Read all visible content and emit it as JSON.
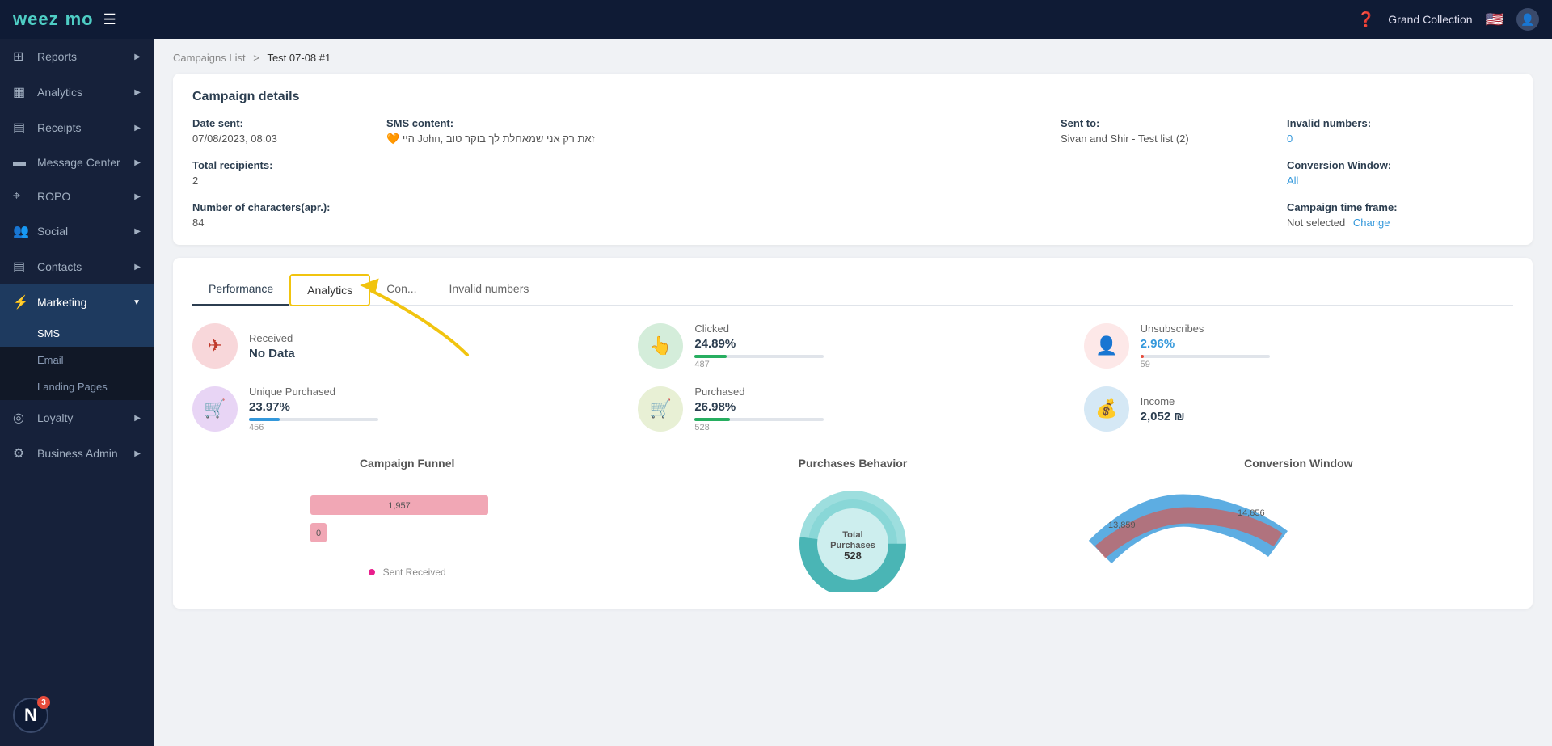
{
  "app": {
    "name_part1": "weez",
    "name_part2": "mo",
    "store": "Grand Collection"
  },
  "topnav": {
    "help_label": "?",
    "flag": "🇺🇸"
  },
  "sidebar": {
    "items": [
      {
        "id": "reports",
        "label": "Reports",
        "icon": "⊞",
        "expandable": true
      },
      {
        "id": "analytics",
        "label": "Analytics",
        "icon": "▦",
        "expandable": true
      },
      {
        "id": "receipts",
        "label": "Receipts",
        "icon": "▤",
        "expandable": true
      },
      {
        "id": "message-center",
        "label": "Message Center",
        "icon": "▬",
        "expandable": true
      },
      {
        "id": "ropo",
        "label": "ROPO",
        "icon": "⌖",
        "expandable": true
      },
      {
        "id": "social",
        "label": "Social",
        "icon": "👥",
        "expandable": true
      },
      {
        "id": "contacts",
        "label": "Contacts",
        "icon": "▤",
        "expandable": true
      },
      {
        "id": "marketing",
        "label": "Marketing",
        "icon": "⚡",
        "expandable": true,
        "active": true
      },
      {
        "id": "loyalty",
        "label": "Loyalty",
        "icon": "◎",
        "expandable": true
      },
      {
        "id": "business-admin",
        "label": "Business Admin",
        "icon": "⚙",
        "expandable": true
      }
    ],
    "sub_items": [
      {
        "id": "sms",
        "label": "SMS",
        "active": true
      },
      {
        "id": "email",
        "label": "Email",
        "active": false
      },
      {
        "id": "landing-pages",
        "label": "Landing Pages",
        "active": false
      }
    ],
    "notification": {
      "count": "3"
    }
  },
  "breadcrumb": {
    "parent": "Campaigns List",
    "separator": ">",
    "current": "Test 07-08 #1"
  },
  "campaign_details": {
    "title": "Campaign details",
    "date_sent_label": "Date sent:",
    "date_sent_value": "07/08/2023, 08:03",
    "total_recipients_label": "Total recipients:",
    "total_recipients_value": "2",
    "num_characters_label": "Number of characters(apr.):",
    "num_characters_value": "84",
    "sms_content_label": "SMS content:",
    "sms_content_emoji": "🧡",
    "sms_content_text": "היי John, זאת רק אני שמאחלת לך בוקר טוב",
    "sent_to_label": "Sent to:",
    "sent_to_value": "Sivan and Shir - Test list (2)",
    "invalid_numbers_label": "Invalid numbers:",
    "invalid_numbers_value": "0",
    "conversion_window_label": "Conversion Window:",
    "conversion_window_value": "All",
    "campaign_timeframe_label": "Campaign time frame:",
    "campaign_timeframe_not_selected": "Not selected",
    "campaign_timeframe_change": "Change"
  },
  "tabs": [
    {
      "id": "performance",
      "label": "Performance",
      "active": true
    },
    {
      "id": "analytics",
      "label": "Analytics",
      "active": false,
      "highlighted": true
    },
    {
      "id": "conversion",
      "label": "Con...",
      "active": false
    },
    {
      "id": "invalid",
      "label": "Invalid numbers",
      "active": false
    }
  ],
  "annotation": {
    "tab_pointing_to": "Analytics"
  },
  "stats": [
    {
      "id": "received",
      "title": "Received",
      "value": "No Data",
      "icon_type": "pink",
      "icon": "✈",
      "show_bar": false,
      "colored": false
    },
    {
      "id": "clicked",
      "title": "Clicked",
      "value": "24.89%",
      "count": "487",
      "icon_type": "green",
      "icon": "👆",
      "bar_width": "25",
      "bar_color": "green-bar",
      "show_bar": true,
      "colored": false
    },
    {
      "id": "unsubscribes",
      "title": "Unsubscribes",
      "value": "2.96%",
      "count": "59",
      "icon_type": "red-outline",
      "icon": "👤",
      "bar_width": "3",
      "bar_color": "red-bar",
      "show_bar": true,
      "colored": true
    },
    {
      "id": "unique-purchased",
      "title": "Unique Purchased",
      "value": "23.97%",
      "count": "456",
      "icon_type": "purple",
      "icon": "🛒",
      "bar_width": "24",
      "bar_color": "blue-bar",
      "show_bar": true,
      "colored": false
    },
    {
      "id": "purchased",
      "title": "Purchased",
      "value": "26.98%",
      "count": "528",
      "icon_type": "olive",
      "icon": "🛒",
      "bar_width": "27",
      "bar_color": "green-bar",
      "show_bar": true,
      "colored": false
    },
    {
      "id": "income",
      "title": "Income",
      "value": "2,052 ₪",
      "icon_type": "blue",
      "icon": "💰",
      "show_bar": false,
      "colored": false
    }
  ],
  "bottom_sections": {
    "funnel": {
      "title": "Campaign Funnel",
      "bars": [
        {
          "label": "",
          "value": "1,957",
          "width": 90,
          "color": "#f1a7b5"
        },
        {
          "label": "",
          "value": "0",
          "width": 10,
          "color": "#f1a7b5"
        }
      ],
      "legend": [
        {
          "color": "#f08",
          "label": "Sent Received"
        }
      ]
    },
    "purchases": {
      "title": "Purchases Behavior",
      "donut_label": "Total\nPurchases\n528"
    },
    "conversion": {
      "title": "Conversion Window",
      "values": [
        {
          "label": "13,859",
          "color": "#3498db"
        },
        {
          "label": "14,856",
          "color": "#e74c3c"
        }
      ]
    }
  }
}
